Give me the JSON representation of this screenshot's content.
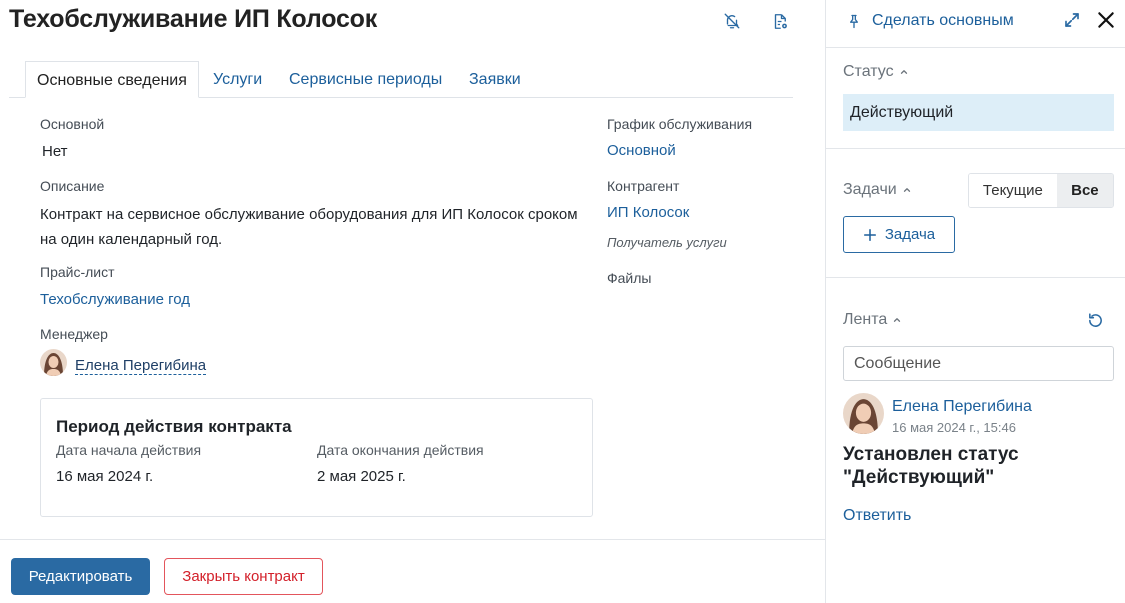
{
  "header": {
    "title": "Техобслуживание ИП Колосок"
  },
  "tabs": [
    {
      "label": "Основные сведения",
      "active": true
    },
    {
      "label": "Услуги",
      "active": false
    },
    {
      "label": "Сервисные периоды",
      "active": false
    },
    {
      "label": "Заявки",
      "active": false
    }
  ],
  "fields": {
    "main_label": "Основной",
    "main_value": "Нет",
    "description_label": "Описание",
    "description_value": "Контракт на сервисное обслуживание оборудования для ИП Колосок сроком на один календарный год.",
    "pricelist_label": "Прайс-лист",
    "pricelist_value": "Техобслуживание год",
    "manager_label": "Менеджер",
    "manager_value": "Елена Перегибина",
    "schedule_label": "График обслуживания",
    "schedule_value": "Основной",
    "counterparty_label": "Контрагент",
    "counterparty_value": "ИП Колосок",
    "counterparty_role": "Получатель услуги",
    "files_label": "Файлы"
  },
  "period": {
    "title": "Период действия контракта",
    "start_label": "Дата начала действия",
    "start_value": "16 мая 2024 г.",
    "end_label": "Дата окончания действия",
    "end_value": "2 мая 2025 г."
  },
  "footer": {
    "edit_label": "Редактировать",
    "close_label": "Закрыть контракт"
  },
  "sidebar": {
    "make_main_label": "Сделать основным",
    "status_heading": "Статус",
    "status_value": "Действующий",
    "tasks_heading": "Задачи",
    "filter_current": "Текущие",
    "filter_all": "Все",
    "add_task_label": "Задача",
    "feed_heading": "Лента",
    "message_placeholder": "Сообщение",
    "feed_item": {
      "author": "Елена Перегибина",
      "timestamp": "16 мая 2024 г., 15:46",
      "text": "Установлен статус \"Действующий\"",
      "reply_label": "Ответить"
    }
  },
  "colors": {
    "accent": "#2a6aa3",
    "link": "#1c5f9b",
    "danger": "#d3202a",
    "status_bg": "#ddeef8"
  },
  "icons": [
    "bell-off-icon",
    "document-settings-icon",
    "pin-icon",
    "expand-icon",
    "close-icon",
    "chevron-up-icon",
    "plus-icon",
    "refresh-icon"
  ]
}
